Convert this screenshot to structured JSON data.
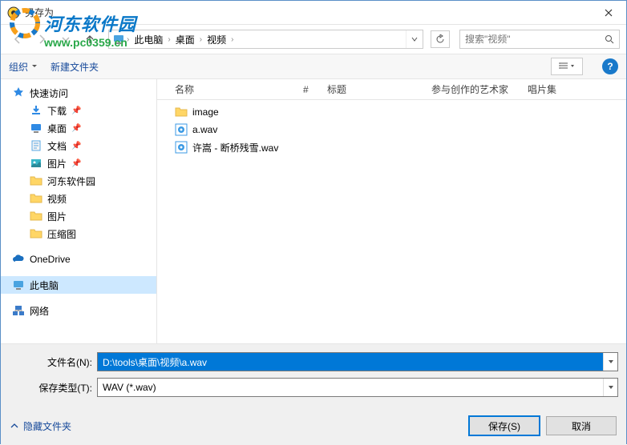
{
  "window": {
    "title": "另存为"
  },
  "watermark": {
    "text": "河东软件园",
    "url": "www.pc0359.cn"
  },
  "breadcrumb": {
    "parts": [
      "此电脑",
      "桌面",
      "视频"
    ]
  },
  "search": {
    "placeholder": "搜索\"视频\""
  },
  "toolbar": {
    "organize": "组织",
    "newfolder": "新建文件夹"
  },
  "columns": {
    "name": "名称",
    "num": "#",
    "title": "标题",
    "artist": "参与创作的艺术家",
    "album": "唱片集"
  },
  "tree": {
    "quick": "快速访问",
    "downloads": "下载",
    "desktop": "桌面",
    "documents": "文档",
    "pictures": "图片",
    "hedong": "河东软件园",
    "video": "视频",
    "pictures2": "图片",
    "compressed": "压缩图",
    "onedrive": "OneDrive",
    "thispc": "此电脑",
    "network": "网络"
  },
  "files": [
    {
      "name": "image",
      "type": "folder"
    },
    {
      "name": "a.wav",
      "type": "wav"
    },
    {
      "name": "许嵩 - 断桥残雪.wav",
      "type": "wav"
    }
  ],
  "form": {
    "filename_label": "文件名(N):",
    "filename_value": "D:\\tools\\桌面\\视频\\a.wav",
    "type_label": "保存类型(T):",
    "type_value": "WAV (*.wav)"
  },
  "footer": {
    "hide": "隐藏文件夹",
    "save": "保存(S)",
    "cancel": "取消"
  }
}
